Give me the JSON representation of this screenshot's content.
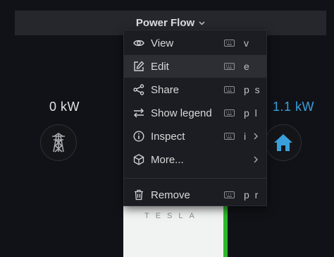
{
  "panel": {
    "title": "Power Flow",
    "icon": "chevron-down-icon"
  },
  "flow": {
    "grid_power": "0 kW",
    "home_power": "1.1 kW",
    "grid_icon": "power-tower-icon",
    "home_icon": "home-icon",
    "battery_brand": "TESLA"
  },
  "colors": {
    "accent_blue": "#3aa0dc",
    "battery_green": "#2eb82e",
    "menu_bg": "#1c1d22",
    "active_bg": "#2c2e34"
  },
  "menu": {
    "items": [
      {
        "label": "View",
        "shortcut": "v",
        "icon": "eye-icon"
      },
      {
        "label": "Edit",
        "shortcut": "e",
        "icon": "edit-icon"
      },
      {
        "label": "Share",
        "shortcut": "p s",
        "icon": "share-icon"
      },
      {
        "label": "Show legend",
        "shortcut": "p l",
        "icon": "arrows-exchange-icon"
      },
      {
        "label": "Inspect",
        "shortcut": "i",
        "icon": "info-circle-icon"
      },
      {
        "label": "More...",
        "shortcut": "",
        "icon": "cube-icon"
      },
      {
        "label": "Remove",
        "shortcut": "p r",
        "icon": "trash-icon"
      }
    ]
  }
}
